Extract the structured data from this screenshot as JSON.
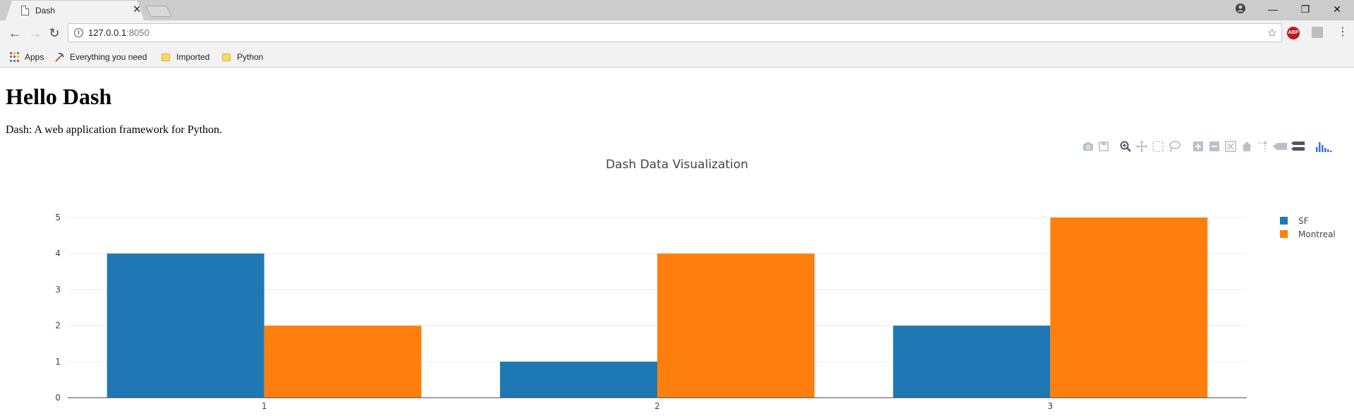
{
  "browser": {
    "tab_title": "Dash",
    "url_host": "127.0.0.1",
    "url_port": ":8050",
    "bookmarks": [
      "Apps",
      "Everything you need",
      "Imported",
      "Python"
    ],
    "extension_abp": "ABP"
  },
  "page": {
    "title": "Hello Dash",
    "description": "Dash: A web application framework for Python."
  },
  "modebar": {
    "icons": [
      "camera-icon",
      "save-icon",
      "zoom-icon",
      "pan-icon",
      "box-select-icon",
      "lasso-icon",
      "zoom-in-icon",
      "zoom-out-icon",
      "autoscale-icon",
      "reset-axes-icon",
      "spike-lines-icon",
      "hover-closest-icon",
      "hover-compare-icon",
      "plotly-logo-icon"
    ]
  },
  "chart_data": {
    "type": "bar",
    "title": "Dash Data Visualization",
    "categories": [
      "1",
      "2",
      "3"
    ],
    "series": [
      {
        "name": "SF",
        "values": [
          4,
          1,
          2
        ],
        "color": "#1f77b4"
      },
      {
        "name": "Montreal",
        "values": [
          2,
          4,
          5
        ],
        "color": "#ff7f0e"
      }
    ],
    "ylim": [
      0,
      5
    ],
    "y_ticks": [
      "0",
      "1",
      "2",
      "3",
      "4",
      "5"
    ],
    "grid": true,
    "legend_position": "top-right"
  }
}
